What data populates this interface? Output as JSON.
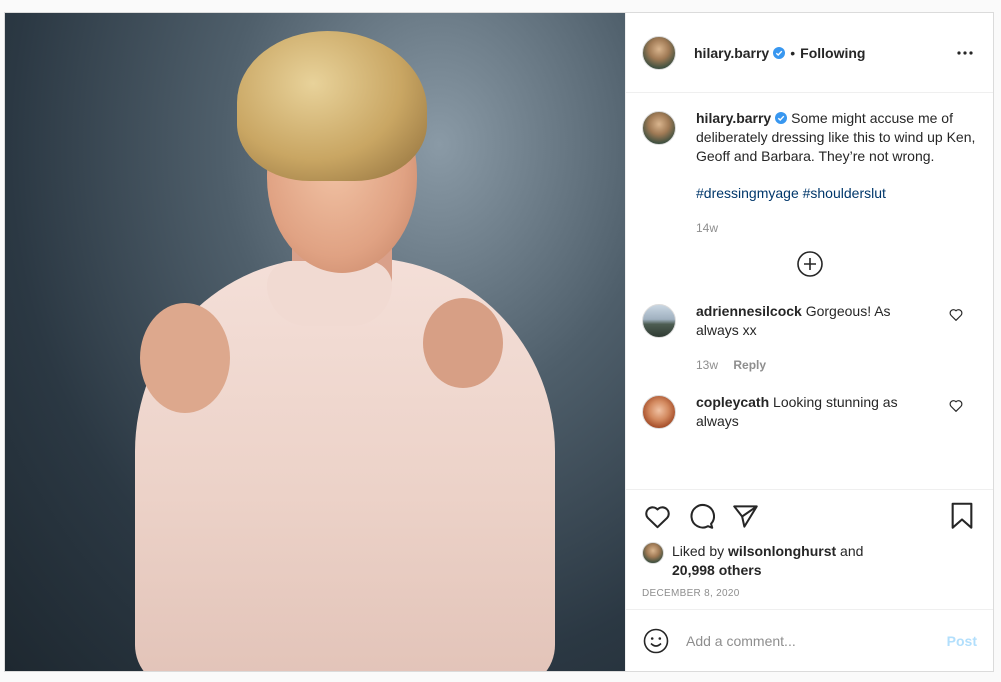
{
  "post": {
    "header": {
      "username": "hilary.barry",
      "separator": "•",
      "follow_status": "Following"
    },
    "caption": {
      "username": "hilary.barry",
      "text": "Some might accuse me of deliberately dressing like this to wind up Ken, Geoff and Barbara. They’re not wrong.",
      "hashtags": "#dressingmyage #shoulderslut",
      "age": "14w"
    },
    "comments": [
      {
        "username": "adriennesilcock",
        "text": "Gorgeous! As always xx",
        "age": "13w",
        "reply_label": "Reply"
      },
      {
        "username": "copleycath",
        "text": "Looking stunning as always"
      }
    ],
    "likes": {
      "prefix": "Liked by",
      "liker": "wilsonlonghurst",
      "conjunction": "and",
      "others": "20,998 others"
    },
    "date": "DECEMBER 8, 2020",
    "add_comment": {
      "placeholder": "Add a comment...",
      "post_label": "Post"
    },
    "colors": {
      "verified": "#3897f0",
      "hashtag": "#00376b",
      "post_button_disabled": "#b2dffc",
      "muted": "#8e8e8e"
    }
  }
}
